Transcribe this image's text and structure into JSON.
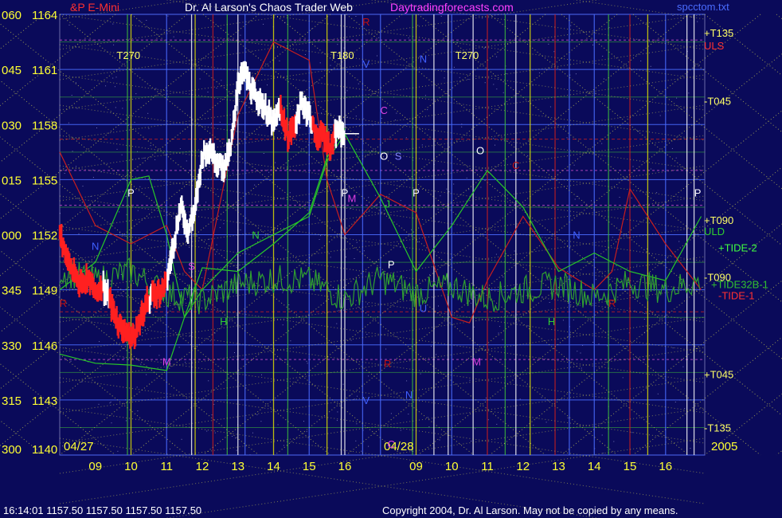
{
  "header": {
    "symbol": "&P E-Mini",
    "title": "Dr. Al Larson's Chaos Trader Web",
    "site": "Daytradingforecasts.com",
    "file": "spcctom.txt"
  },
  "footer": {
    "readout": "16:14:01  1157.50 1157.50 1157.50 1157.50",
    "copyright": "Copyright 2004, Dr. Al Larson. May not be copied by any means."
  },
  "colors": {
    "background": "#0a0a5a",
    "grid_yellow": "#e6e600",
    "grid_green": "#3cb83c",
    "grid_blue": "#4a6cff",
    "grid_red": "#c81e1e",
    "grid_white": "#ffffff",
    "price_white": "#ffffff",
    "price_red": "#ff2020",
    "tide1": "#c81e1e",
    "tide2": "#28c828",
    "tide32b": "#30a030",
    "diag": "#e0e050"
  },
  "chart_data": {
    "type": "line",
    "ylim": [
      1140,
      1164
    ],
    "y_ticks": [
      {
        "angle": "060",
        "price": "1164"
      },
      {
        "angle": "045",
        "price": "1161"
      },
      {
        "angle": "030",
        "price": "1158"
      },
      {
        "angle": "015",
        "price": "1155"
      },
      {
        "angle": "000",
        "price": "1152"
      },
      {
        "angle": "345",
        "price": "1149"
      },
      {
        "angle": "330",
        "price": "1146"
      },
      {
        "angle": "315",
        "price": "1143"
      },
      {
        "angle": "300",
        "price": "1140"
      }
    ],
    "x_hours": [
      "09",
      "10",
      "11",
      "12",
      "13",
      "14",
      "15",
      "16",
      "09",
      "10",
      "11",
      "12",
      "13",
      "14",
      "15",
      "16"
    ],
    "dates": [
      "04/27",
      "04/28"
    ],
    "year": "2005",
    "time_labels": [
      {
        "text": "T270",
        "hour": 10.0
      },
      {
        "text": "T180",
        "hour": 16.0
      },
      {
        "text": "T270",
        "hour": 19.5
      }
    ],
    "right_labels": [
      {
        "text": "+T135",
        "y": 1163,
        "color": "#ffff66"
      },
      {
        "text": "ULS",
        "y": 1162.3,
        "color": "#ff3030"
      },
      {
        "text": "-T045",
        "y": 1159.3,
        "color": "#ffff66"
      },
      {
        "text": "+T090",
        "y": 1152.8,
        "color": "#ffff66"
      },
      {
        "text": "ULD",
        "y": 1152.2,
        "color": "#30d030"
      },
      {
        "text": "+TIDE-2",
        "y": 1151.3,
        "color": "#40ff40"
      },
      {
        "text": "-T090",
        "y": 1149.7,
        "color": "#ffff66"
      },
      {
        "text": "+TIDE32B-1",
        "y": 1149.3,
        "color": "#30c030"
      },
      {
        "text": "-TIDE-1",
        "y": 1148.7,
        "color": "#ff3030"
      },
      {
        "text": "+T045",
        "y": 1144.4,
        "color": "#ffff66"
      },
      {
        "text": "-T135",
        "y": 1141.5,
        "color": "#ffff66"
      }
    ],
    "planet_labels": [
      {
        "text": "R",
        "hour": 16.6,
        "y": 1163.6,
        "color": "#c01010"
      },
      {
        "text": "V",
        "hour": 16.6,
        "y": 1161.3,
        "color": "#4060ff"
      },
      {
        "text": "N",
        "hour": 18.2,
        "y": 1161.6,
        "color": "#4060ff"
      },
      {
        "text": "C",
        "hour": 17.1,
        "y": 1158.8,
        "color": "#e040e0"
      },
      {
        "text": "O",
        "hour": 17.1,
        "y": 1156.3,
        "color": "#ffffff"
      },
      {
        "text": "S",
        "hour": 17.5,
        "y": 1156.3,
        "color": "#8080ff"
      },
      {
        "text": "M",
        "hour": 16.2,
        "y": 1154.0,
        "color": "#e040e0"
      },
      {
        "text": "J",
        "hour": 17.2,
        "y": 1153.7,
        "color": "#30d030"
      },
      {
        "text": "P",
        "hour": 17.3,
        "y": 1150.4,
        "color": "#ffffff"
      },
      {
        "text": "U",
        "hour": 18.2,
        "y": 1148.0,
        "color": "#4060ff"
      },
      {
        "text": "R",
        "hour": 17.2,
        "y": 1145.0,
        "color": "#c01010"
      },
      {
        "text": "N",
        "hour": 17.8,
        "y": 1143.3,
        "color": "#4060ff"
      },
      {
        "text": "V",
        "hour": 16.6,
        "y": 1143.0,
        "color": "#4060ff"
      },
      {
        "text": "C",
        "hour": 17.3,
        "y": 1140.6,
        "color": "#e040e0"
      },
      {
        "text": "P",
        "hour": 10.0,
        "y": 1154.3,
        "color": "#ffffff"
      },
      {
        "text": "P",
        "hour": 16.0,
        "y": 1154.3,
        "color": "#ffffff"
      },
      {
        "text": "P",
        "hour": 18.0,
        "y": 1154.3,
        "color": "#ffffff"
      },
      {
        "text": "P",
        "hour": 25.9,
        "y": 1154.3,
        "color": "#ffffff"
      },
      {
        "text": "O",
        "hour": 19.8,
        "y": 1156.6,
        "color": "#ffffff"
      },
      {
        "text": "C",
        "hour": 20.8,
        "y": 1155.8,
        "color": "#c01010"
      },
      {
        "text": "N",
        "hour": 13.5,
        "y": 1152.0,
        "color": "#30d030"
      },
      {
        "text": "N",
        "hour": 22.5,
        "y": 1152.0,
        "color": "#4060ff"
      },
      {
        "text": "S",
        "hour": 11.7,
        "y": 1150.3,
        "color": "#e040e0"
      },
      {
        "text": "H",
        "hour": 12.6,
        "y": 1147.3,
        "color": "#30d030"
      },
      {
        "text": "H",
        "hour": 21.8,
        "y": 1147.3,
        "color": "#30d030"
      },
      {
        "text": "M",
        "hour": 11.0,
        "y": 1145.1,
        "color": "#e040e0"
      },
      {
        "text": "M",
        "hour": 19.7,
        "y": 1145.1,
        "color": "#e040e0"
      },
      {
        "text": "R",
        "hour": 23.5,
        "y": 1148.3,
        "color": "#c01010"
      },
      {
        "text": "N",
        "hour": 9.0,
        "y": 1151.4,
        "color": "#4060ff"
      },
      {
        "text": "R",
        "hour": 8.1,
        "y": 1148.3,
        "color": "#c01010"
      }
    ],
    "price_series": {
      "name": "",
      "hours": [
        8.0,
        8.2,
        8.4,
        8.6,
        8.8,
        9.0,
        9.2,
        9.4,
        9.6,
        9.8,
        10.0,
        10.2,
        10.4,
        10.6,
        10.8,
        11.0,
        11.2,
        11.4,
        11.6,
        11.8,
        12.0,
        12.2,
        12.4,
        12.6,
        12.8,
        13.0,
        13.2,
        13.4,
        13.6,
        13.8,
        14.0,
        14.2,
        14.4,
        14.6,
        14.8,
        15.0,
        15.2,
        15.4,
        15.6,
        15.8,
        16.0
      ],
      "values": [
        1152.0,
        1150.8,
        1149.8,
        1149.4,
        1149.7,
        1148.8,
        1149.3,
        1148.4,
        1147.4,
        1146.8,
        1146.4,
        1146.9,
        1148.2,
        1148.7,
        1148.9,
        1149.4,
        1151.6,
        1153.6,
        1152.2,
        1153.4,
        1156.3,
        1156.8,
        1156.0,
        1155.7,
        1156.6,
        1160.3,
        1160.9,
        1159.7,
        1159.4,
        1158.7,
        1158.0,
        1158.9,
        1157.3,
        1158.0,
        1159.2,
        1158.6,
        1157.3,
        1157.5,
        1156.7,
        1157.7,
        1157.5
      ]
    },
    "price_red_segments": [
      [
        8.0,
        9.2
      ],
      [
        9.4,
        10.5
      ],
      [
        10.6,
        11.0
      ],
      [
        14.2,
        14.6
      ],
      [
        15.1,
        15.7
      ]
    ],
    "curves": [
      {
        "name": "TIDE-1",
        "color": "#c81e1e",
        "hours": [
          8.0,
          9.0,
          10.0,
          11.0,
          11.5,
          12.0,
          13.0,
          14.0,
          15.0,
          15.5,
          16.0,
          17.0,
          18.0,
          19.0,
          19.5,
          20.0,
          21.0,
          22.0,
          23.0,
          23.5,
          24.0,
          25.0,
          26.0
        ],
        "values": [
          1156.5,
          1152.5,
          1151.5,
          1152.5,
          1150.0,
          1149.0,
          1158.5,
          1162.5,
          1161.5,
          1155.0,
          1152.0,
          1154.2,
          1153.2,
          1147.5,
          1147.2,
          1149.5,
          1153.0,
          1150.2,
          1149.0,
          1150.0,
          1154.5,
          1151.5,
          1149.0
        ]
      },
      {
        "name": "TIDE-2",
        "color": "#28c828",
        "hours": [
          8.0,
          9.0,
          10.0,
          10.5,
          11.0,
          11.5,
          12.0,
          13.0,
          14.0,
          15.0,
          15.5,
          16.0,
          17.0,
          18.0,
          19.0,
          20.0,
          21.0,
          22.0,
          23.0,
          24.0,
          25.0,
          26.0
        ],
        "values": [
          1149.0,
          1150.5,
          1155.0,
          1155.2,
          1152.0,
          1147.5,
          1149.0,
          1151.0,
          1152.0,
          1153.0,
          1156.0,
          1157.5,
          1154.0,
          1150.0,
          1152.5,
          1155.5,
          1153.5,
          1150.0,
          1151.0,
          1150.0,
          1149.5,
          1153.0
        ]
      },
      {
        "name": "TIDE32B-1",
        "color": "#30a030",
        "noisy": true,
        "hours": [
          8.0,
          9.0,
          10.0,
          11.0,
          12.0,
          13.0,
          14.0,
          15.0,
          16.0,
          17.0,
          18.0,
          19.0,
          20.0,
          21.0,
          22.0,
          23.0,
          24.0,
          25.0,
          26.0
        ],
        "values": [
          1150.0,
          1149.5,
          1150.0,
          1148.8,
          1148.4,
          1149.3,
          1149.6,
          1149.5,
          1148.5,
          1149.6,
          1148.8,
          1149.2,
          1148.5,
          1149.0,
          1149.3,
          1148.6,
          1149.4,
          1149.0,
          1149.5
        ]
      },
      {
        "name": "envelope",
        "color": "#28c828",
        "hours": [
          8.0,
          9.0,
          10.0,
          11.0,
          11.5,
          12.0,
          13.0,
          14.0,
          15.0,
          15.5,
          16.0
        ],
        "values": [
          1145.5,
          1145.0,
          1144.9,
          1144.6,
          1147.5,
          1150.2,
          1150.0,
          1151.5,
          1153.2,
          1156.2,
          1157.8
        ]
      }
    ]
  }
}
